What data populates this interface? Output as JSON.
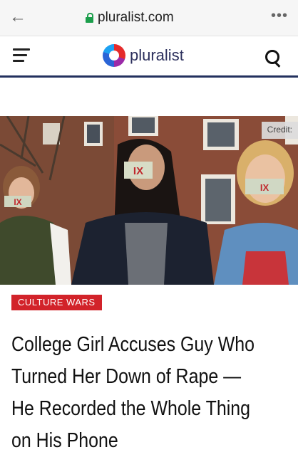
{
  "browser": {
    "url": "pluralist.com",
    "icons": {
      "back": "back-arrow-icon",
      "lock": "lock-icon",
      "more": "more-icon"
    }
  },
  "site": {
    "logo_text": "pluralist",
    "icons": {
      "menu": "hamburger-menu-icon",
      "search": "search-icon"
    },
    "colors": {
      "header_border": "#23315e",
      "logo_text": "#2b2f5c"
    }
  },
  "hero": {
    "credit_label": "Credit:",
    "sign_text": "IX"
  },
  "article": {
    "category": "CULTURE WARS",
    "category_color": "#d2232a",
    "headline_lines": [
      "College Girl Accuses Guy Who",
      "Turned Her Down of Rape —",
      "He Recorded the Whole Thing",
      "on His Phone"
    ]
  }
}
